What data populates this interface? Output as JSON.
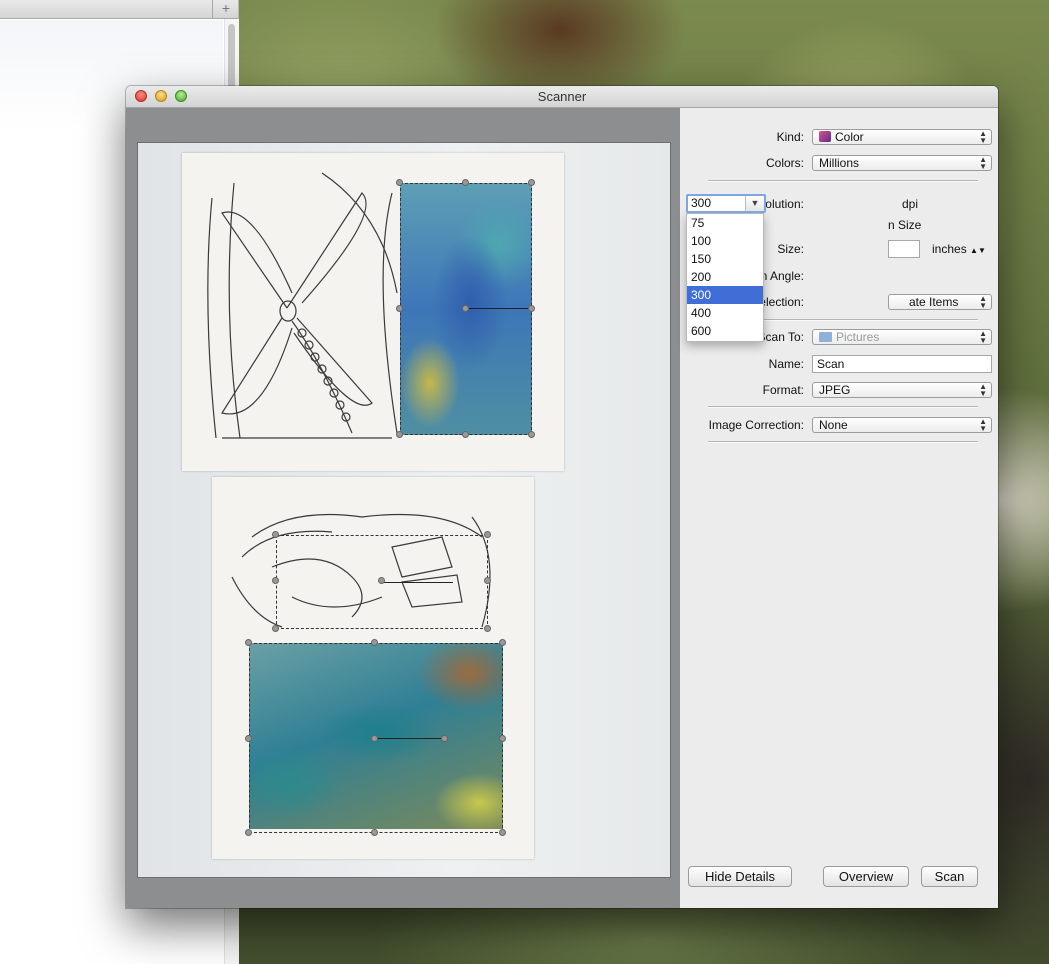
{
  "window": {
    "title": "Scanner"
  },
  "background_window": {
    "plus_label": "+"
  },
  "details": {
    "kind": {
      "label": "Kind:",
      "value": "Color",
      "icon": "color-flower-icon"
    },
    "colors": {
      "label": "Colors:",
      "value": "Millions"
    },
    "resolution": {
      "label": "Resolution:",
      "value": "300",
      "unit": "dpi",
      "options": [
        "75",
        "100",
        "150",
        "200",
        "300",
        "400",
        "600"
      ],
      "selected_option": "300"
    },
    "use_custom_size": {
      "partial_label": "n Size"
    },
    "size": {
      "label": "Size:",
      "unit": "inches"
    },
    "rotation_angle": {
      "label": "Rotation Angle:"
    },
    "auto_selection": {
      "label": "Auto Selection:",
      "partial_value": "ate Items"
    },
    "scan_to": {
      "label": "Scan To:",
      "partial_value": "Pictures"
    },
    "name": {
      "label": "Name:",
      "value": "Scan"
    },
    "format": {
      "label": "Format:",
      "value": "JPEG"
    },
    "image_correction": {
      "label": "Image Correction:",
      "value": "None"
    }
  },
  "buttons": {
    "hide_details": "Hide Details",
    "overview": "Overview",
    "scan": "Scan"
  },
  "colors": {
    "accent_selection": "#3f6fd6",
    "focus_ring": "#7ea6e0",
    "preview_background": "#8c8e90"
  }
}
